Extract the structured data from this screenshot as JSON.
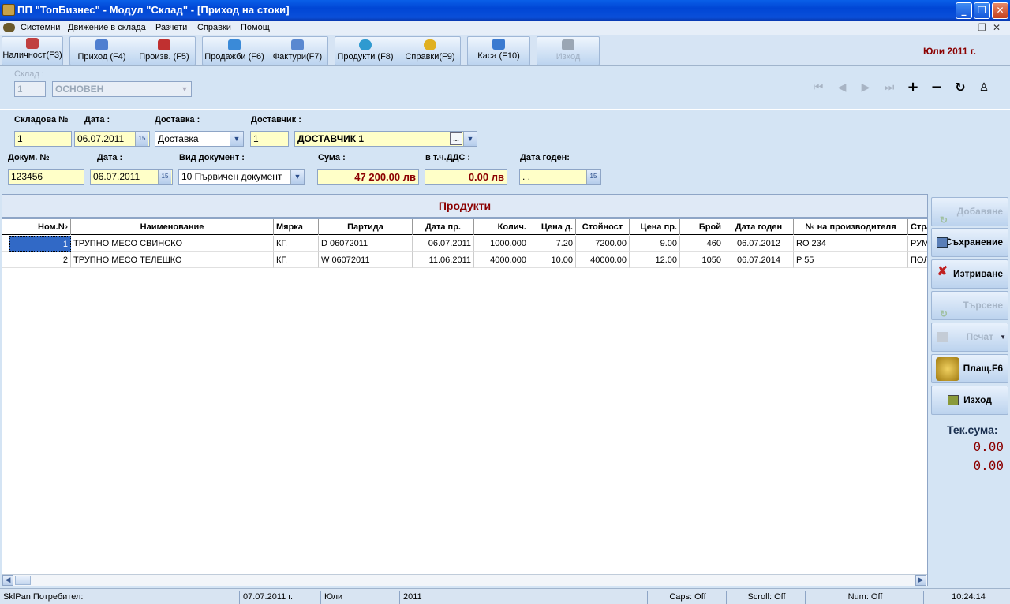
{
  "window": {
    "title": "ПП \"ТопБизнес\" - Модул \"Склад\" - [Приход на стоки]"
  },
  "menu": [
    "Системни",
    "Движение в склада",
    "Разчети",
    "Справки",
    "Помощ"
  ],
  "toolbar": {
    "availability": "Наличност(F3)",
    "income": "Приход (F4)",
    "production": "Произв. (F5)",
    "sales": "Продажби (F6)",
    "invoices": "Фактури(F7)",
    "products": "Продукти (F8)",
    "reports": "Справки(F9)",
    "cash": "Каса (F10)",
    "exit": "Изход"
  },
  "period_label": "Юли  2011 г.",
  "warehouse": {
    "label": "Склад :",
    "number": "1",
    "name": "ОСНОВЕН"
  },
  "form": {
    "store_no_label": "Складова №",
    "store_no": "1",
    "date_label": "Дата :",
    "date": "06.07.2011",
    "delivery_label": "Доставка :",
    "delivery": "Доставка",
    "supplier_label": "Доставчик :",
    "supplier_no": "1",
    "supplier_name": "ДОСТАВЧИК 1",
    "doc_no_label": "Докум. №",
    "doc_no": "123456",
    "doc_date_label": "Дата :",
    "doc_date": "06.07.2011",
    "doc_type_label": "Вид документ :",
    "doc_type": "10 Първичен документ",
    "sum_label": "Сума :",
    "sum": "47 200.00 лв",
    "vat_label": "в т.ч.ДДС :",
    "vat": "0.00 лв",
    "expiry_label": "Дата годен:",
    "expiry": " .  ."
  },
  "grid": {
    "title": "Продукти",
    "columns": [
      "Ном.№",
      "Наименование",
      "Мярка",
      "Партида",
      "Дата пр.",
      "Колич.",
      "Цена д.",
      "Стойност",
      "Цена пр.",
      "Брой",
      "Дата годен",
      "№ на производителя",
      "Стра"
    ],
    "rows": [
      [
        "1",
        "ТРУПНО МЕСО СВИНСКО",
        "КГ.",
        "D 06072011",
        "06.07.2011",
        "1000.000",
        "7.20",
        "7200.00",
        "9.00",
        "460",
        "06.07.2012",
        "RO 234",
        "РУМЪ"
      ],
      [
        "2",
        "ТРУПНО МЕСО ТЕЛЕШКО",
        "КГ.",
        "W 06072011",
        "11.06.2011",
        "4000.000",
        "10.00",
        "40000.00",
        "12.00",
        "1050",
        "06.07.2014",
        "P 55",
        "ПОЛШ"
      ]
    ]
  },
  "side": {
    "add": "Добавяне",
    "save": "Съхранение",
    "delete": "Изтриване",
    "search": "Търсене",
    "print": "Печат",
    "payment": "Плащ.F6",
    "exit": "Изход",
    "cur_sum_label": "Тек.сума:",
    "cur_sum1": "0.00",
    "cur_sum2": "0.00"
  },
  "status": {
    "user": "SklPan Потребител:",
    "date": "07.07.2011 г.",
    "month": "Юли",
    "year": "2011",
    "caps": "Caps: Off",
    "scroll": "Scroll: Off",
    "num": "Num: Off",
    "time": "10:24:14"
  }
}
